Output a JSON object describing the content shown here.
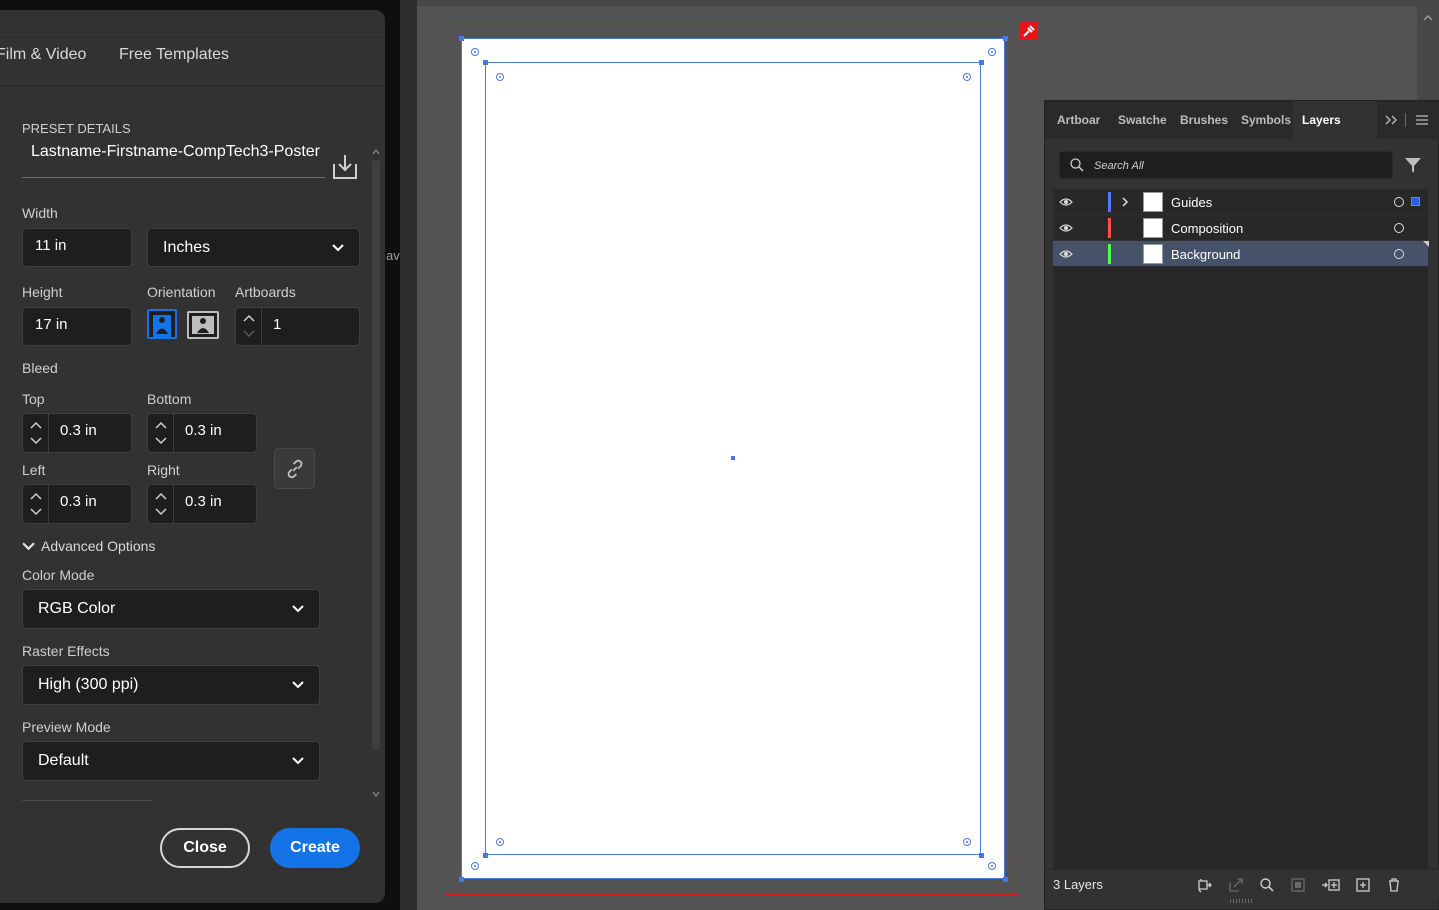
{
  "dialog": {
    "tabs": [
      "Film & Video",
      "Free Templates"
    ],
    "peek_text": "av",
    "preset_heading": "PRESET DETAILS",
    "preset_name": "Lastname-Firstname-CompTech3-Poster",
    "width_label": "Width",
    "width_value": "11 in",
    "units_value": "Inches",
    "height_label": "Height",
    "height_value": "17 in",
    "orientation_label": "Orientation",
    "orientation_selected": "portrait",
    "artboards_label": "Artboards",
    "artboards_value": "1",
    "bleed_label": "Bleed",
    "bleed": {
      "top_label": "Top",
      "top_value": "0.3 in",
      "bottom_label": "Bottom",
      "bottom_value": "0.3 in",
      "left_label": "Left",
      "left_value": "0.3 in",
      "right_label": "Right",
      "right_value": "0.3 in"
    },
    "advanced_label": "Advanced Options",
    "color_mode_label": "Color Mode",
    "color_mode_value": "RGB Color",
    "raster_label": "Raster Effects",
    "raster_value": "High (300 ppi)",
    "preview_label": "Preview Mode",
    "preview_value": "Default",
    "close_label": "Close",
    "create_label": "Create",
    "accent_color": "#1473e6"
  },
  "layers_panel": {
    "tabs": [
      "Artboards",
      "Swatches",
      "Brushes",
      "Symbols",
      "Layers"
    ],
    "tab_display": [
      "Artboar",
      "Swatche",
      "Brushes",
      "Symbols",
      "Layers"
    ],
    "active_tab": "Layers",
    "search_placeholder": "Search All",
    "layers": [
      {
        "name": "Guides",
        "color": "#4f7cff",
        "expandable": true,
        "selected": false,
        "has_selection": true
      },
      {
        "name": "Composition",
        "color": "#ff4f4f",
        "expandable": false,
        "selected": false,
        "has_selection": false
      },
      {
        "name": "Background",
        "color": "#4fff4f",
        "expandable": false,
        "selected": true,
        "has_selection": false
      }
    ],
    "layer_count": "3 Layers",
    "footer_icons": [
      "collect-for-export-icon",
      "export-icon",
      "locate-object-icon",
      "make-clipping-mask-icon",
      "create-sublayer-icon",
      "new-layer-icon",
      "delete-layer-icon"
    ]
  },
  "canvas": {
    "bleed_color": "#d72020",
    "guide_color": "#4a78e0"
  }
}
